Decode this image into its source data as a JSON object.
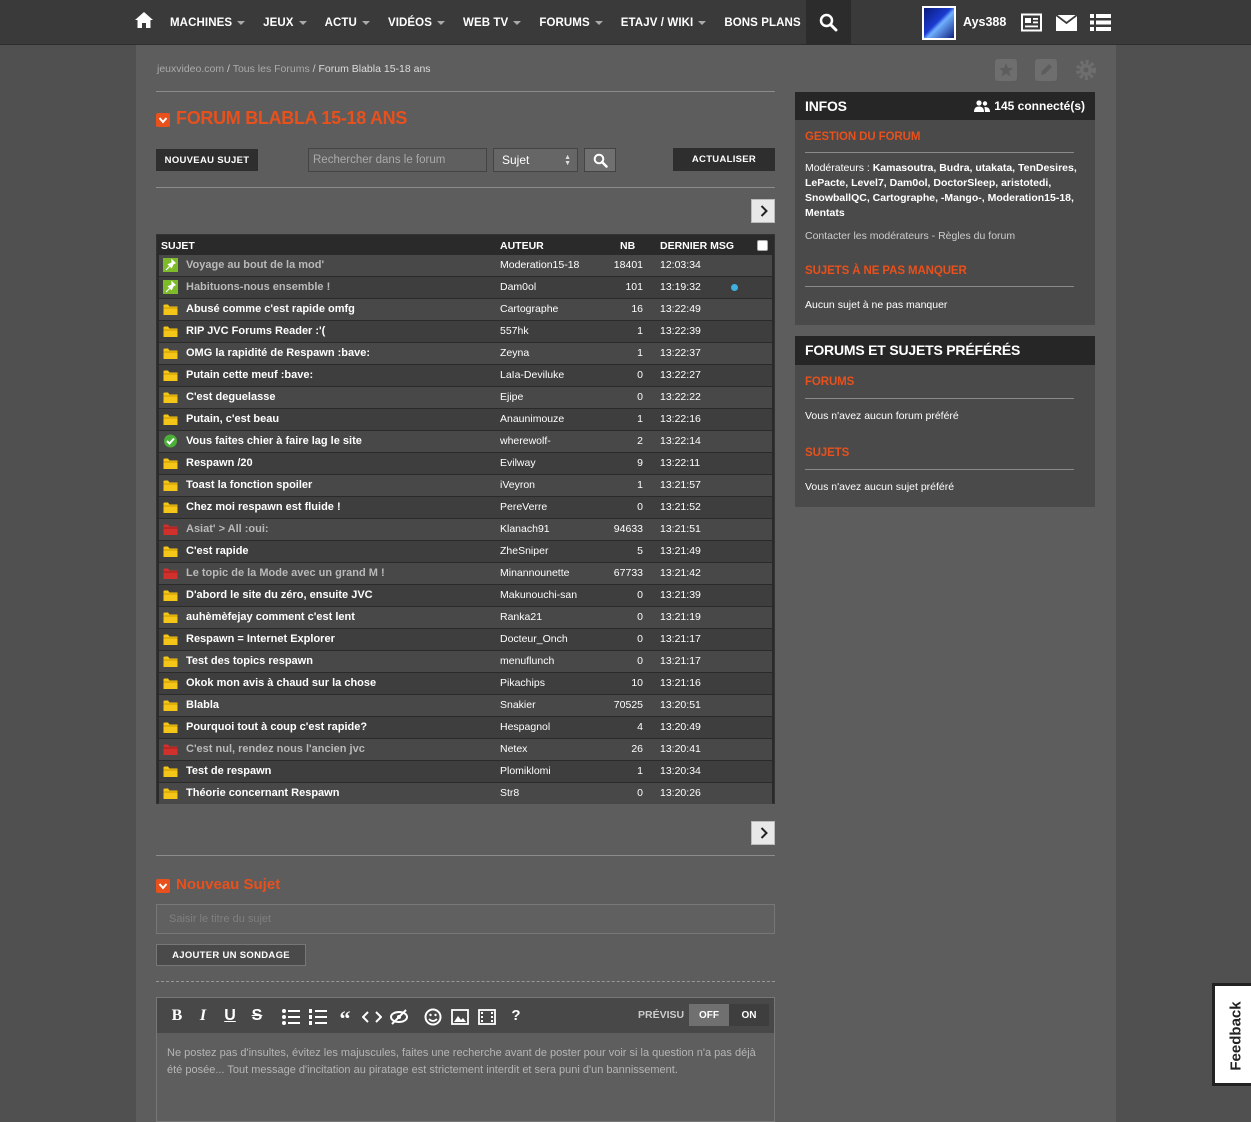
{
  "nav": {
    "items": [
      "MACHINES",
      "JEUX",
      "ACTU",
      "VIDÉOS",
      "WEB TV",
      "FORUMS",
      "ETAJV / WIKI",
      "BONS PLANS"
    ],
    "has_caret": [
      true,
      true,
      true,
      true,
      true,
      true,
      true,
      false
    ],
    "username": "Ays388"
  },
  "breadcrumb": {
    "home": "jeuxvideo.com",
    "all_forums": "Tous les Forums",
    "sep": "/",
    "current": "Forum Blabla 15-18 ans"
  },
  "forum": {
    "title": "FORUM BLABLA 15-18 ANS",
    "new_topic_button": "NOUVEAU SUJET",
    "search_placeholder": "Rechercher dans le forum",
    "search_scope": "Sujet",
    "refresh_button": "ACTUALISER"
  },
  "table": {
    "headers": {
      "subject": "SUJET",
      "author": "AUTEUR",
      "count": "NB",
      "last": "DERNIER MSG"
    },
    "rows": [
      {
        "subject": "Voyage au bout de la mod'",
        "author": "Moderation15-18",
        "nb": "18401",
        "time": "12:03:34",
        "icon": "pin-green-icon",
        "dim": true,
        "new_dot": false
      },
      {
        "subject": "Habituons-nous ensemble !",
        "author": "Dam0ol",
        "nb": "101",
        "time": "13:19:32",
        "icon": "pin-green-icon",
        "dim": true,
        "new_dot": true
      },
      {
        "subject": "Abusé comme c'est rapide omfg",
        "author": "Cartographe",
        "nb": "16",
        "time": "13:22:49",
        "icon": "folder-yellow-icon",
        "dim": false,
        "new_dot": false
      },
      {
        "subject": "RIP JVC Forums Reader :'(",
        "author": "557hk",
        "nb": "1",
        "time": "13:22:39",
        "icon": "folder-yellow-icon",
        "dim": false,
        "new_dot": false
      },
      {
        "subject": "OMG la rapidité de Respawn :bave:",
        "author": "Zeyna",
        "nb": "1",
        "time": "13:22:37",
        "icon": "folder-yellow-icon",
        "dim": false,
        "new_dot": false
      },
      {
        "subject": "Putain cette meuf :bave:",
        "author": "LaIa-Deviluke",
        "nb": "0",
        "time": "13:22:27",
        "icon": "folder-yellow-icon",
        "dim": false,
        "new_dot": false
      },
      {
        "subject": "C'est deguelasse",
        "author": "Ejipe",
        "nb": "0",
        "time": "13:22:22",
        "icon": "folder-yellow-icon",
        "dim": false,
        "new_dot": false
      },
      {
        "subject": "Putain, c'est beau",
        "author": "Anaunimouze",
        "nb": "1",
        "time": "13:22:16",
        "icon": "folder-yellow-icon",
        "dim": false,
        "new_dot": false
      },
      {
        "subject": "Vous faites chier à faire lag le site",
        "author": "wherewolf-",
        "nb": "2",
        "time": "13:22:14",
        "icon": "check-green-icon",
        "dim": false,
        "new_dot": false
      },
      {
        "subject": "Respawn /20",
        "author": "Evilway",
        "nb": "9",
        "time": "13:22:11",
        "icon": "folder-yellow-icon",
        "dim": false,
        "new_dot": false
      },
      {
        "subject": "Toast la fonction spoiler",
        "author": "iVeyron",
        "nb": "1",
        "time": "13:21:57",
        "icon": "folder-yellow-icon",
        "dim": false,
        "new_dot": false
      },
      {
        "subject": "Chez moi respawn est fluide !",
        "author": "PereVerre",
        "nb": "0",
        "time": "13:21:52",
        "icon": "folder-yellow-icon",
        "dim": false,
        "new_dot": false
      },
      {
        "subject": "Asiat' > All :oui:",
        "author": "Klanach91",
        "nb": "94633",
        "time": "13:21:51",
        "icon": "folder-red-icon",
        "dim": true,
        "new_dot": false
      },
      {
        "subject": "C'est rapide",
        "author": "ZheSniper",
        "nb": "5",
        "time": "13:21:49",
        "icon": "folder-yellow-icon",
        "dim": false,
        "new_dot": false
      },
      {
        "subject": "Le topic de la Mode avec un grand M !",
        "author": "Minannounette",
        "nb": "67733",
        "time": "13:21:42",
        "icon": "folder-red-icon",
        "dim": true,
        "new_dot": false
      },
      {
        "subject": "D'abord le site du zéro, ensuite JVC",
        "author": "Makunouchi-san",
        "nb": "0",
        "time": "13:21:39",
        "icon": "folder-yellow-icon",
        "dim": false,
        "new_dot": false
      },
      {
        "subject": "auhèmèfejay comment c'est lent",
        "author": "Ranka21",
        "nb": "0",
        "time": "13:21:19",
        "icon": "folder-yellow-icon",
        "dim": false,
        "new_dot": false
      },
      {
        "subject": "Respawn = Internet Explorer",
        "author": "Docteur_Onch",
        "nb": "0",
        "time": "13:21:17",
        "icon": "folder-yellow-icon",
        "dim": false,
        "new_dot": false
      },
      {
        "subject": "Test des topics respawn",
        "author": "menuflunch",
        "nb": "0",
        "time": "13:21:17",
        "icon": "folder-yellow-icon",
        "dim": false,
        "new_dot": false
      },
      {
        "subject": "Okok mon avis à chaud sur la chose",
        "author": "Pikachips",
        "nb": "10",
        "time": "13:21:16",
        "icon": "folder-yellow-icon",
        "dim": false,
        "new_dot": false
      },
      {
        "subject": "Blabla",
        "author": "Snakier",
        "nb": "70525",
        "time": "13:20:51",
        "icon": "folder-yellow-icon",
        "dim": false,
        "new_dot": false
      },
      {
        "subject": "Pourquoi tout à coup c'est rapide?",
        "author": "Hespagnol",
        "nb": "4",
        "time": "13:20:49",
        "icon": "folder-yellow-icon",
        "dim": false,
        "new_dot": false
      },
      {
        "subject": "C'est nul, rendez nous l'ancien jvc",
        "author": "Netex",
        "nb": "26",
        "time": "13:20:41",
        "icon": "folder-red-icon",
        "dim": true,
        "new_dot": false
      },
      {
        "subject": "Test de respawn",
        "author": "Plomiklomi",
        "nb": "1",
        "time": "13:20:34",
        "icon": "folder-yellow-icon",
        "dim": false,
        "new_dot": false
      },
      {
        "subject": "Théorie concernant Respawn",
        "author": "Str8",
        "nb": "0",
        "time": "13:20:26",
        "icon": "folder-yellow-icon",
        "dim": false,
        "new_dot": false
      }
    ]
  },
  "new_topic": {
    "title": "Nouveau Sujet",
    "subject_placeholder": "Saisir le titre du sujet",
    "poll_button": "AJOUTER UN SONDAGE",
    "preview_label": "PRÉVISU",
    "toggle_off": "OFF",
    "toggle_on": "ON",
    "help_glyph": "?",
    "editor_placeholder": "Ne postez pas d'insultes, évitez les majuscules, faites une recherche avant de poster pour voir si la question n'a pas déjà été posée... Tout message d'incitation au piratage est strictement interdit et sera puni d'un bannissement."
  },
  "sidebar": {
    "infos": {
      "title": "INFOS",
      "online": "145 connecté(s)",
      "gestion_title": "GESTION DU FORUM",
      "moderators_label": "Modérateurs :",
      "moderators": "Kamasoutra, Budra, utakata, TenDesires, LePacte, Level7, Dam0ol, DoctorSleep, aristotedi, SnowballQC, Cartographe, -Mango-, Moderation15-18, Mentats",
      "contact_link": "Contacter les modérateurs",
      "link_sep": " - ",
      "rules_link": "Règles du forum",
      "must_see_title": "SUJETS À NE PAS MANQUER",
      "must_see_text": "Aucun sujet à ne pas manquer"
    },
    "favorites": {
      "title": "FORUMS ET SUJETS PRÉFÉRÉS",
      "forums_title": "FORUMS",
      "forums_text": "Vous n'avez aucun forum préféré",
      "topics_title": "SUJETS",
      "topics_text": "Vous n'avez aucun sujet préféré"
    }
  },
  "feedback": "Feedback",
  "colors": {
    "accent": "#e8501c",
    "background": "#505050",
    "panel_dark": "#262626",
    "new_dot": "#3fb1e0",
    "folder_yellow": "#f5c518",
    "folder_red": "#d0312d",
    "pin_green": "#7dbb2b"
  }
}
